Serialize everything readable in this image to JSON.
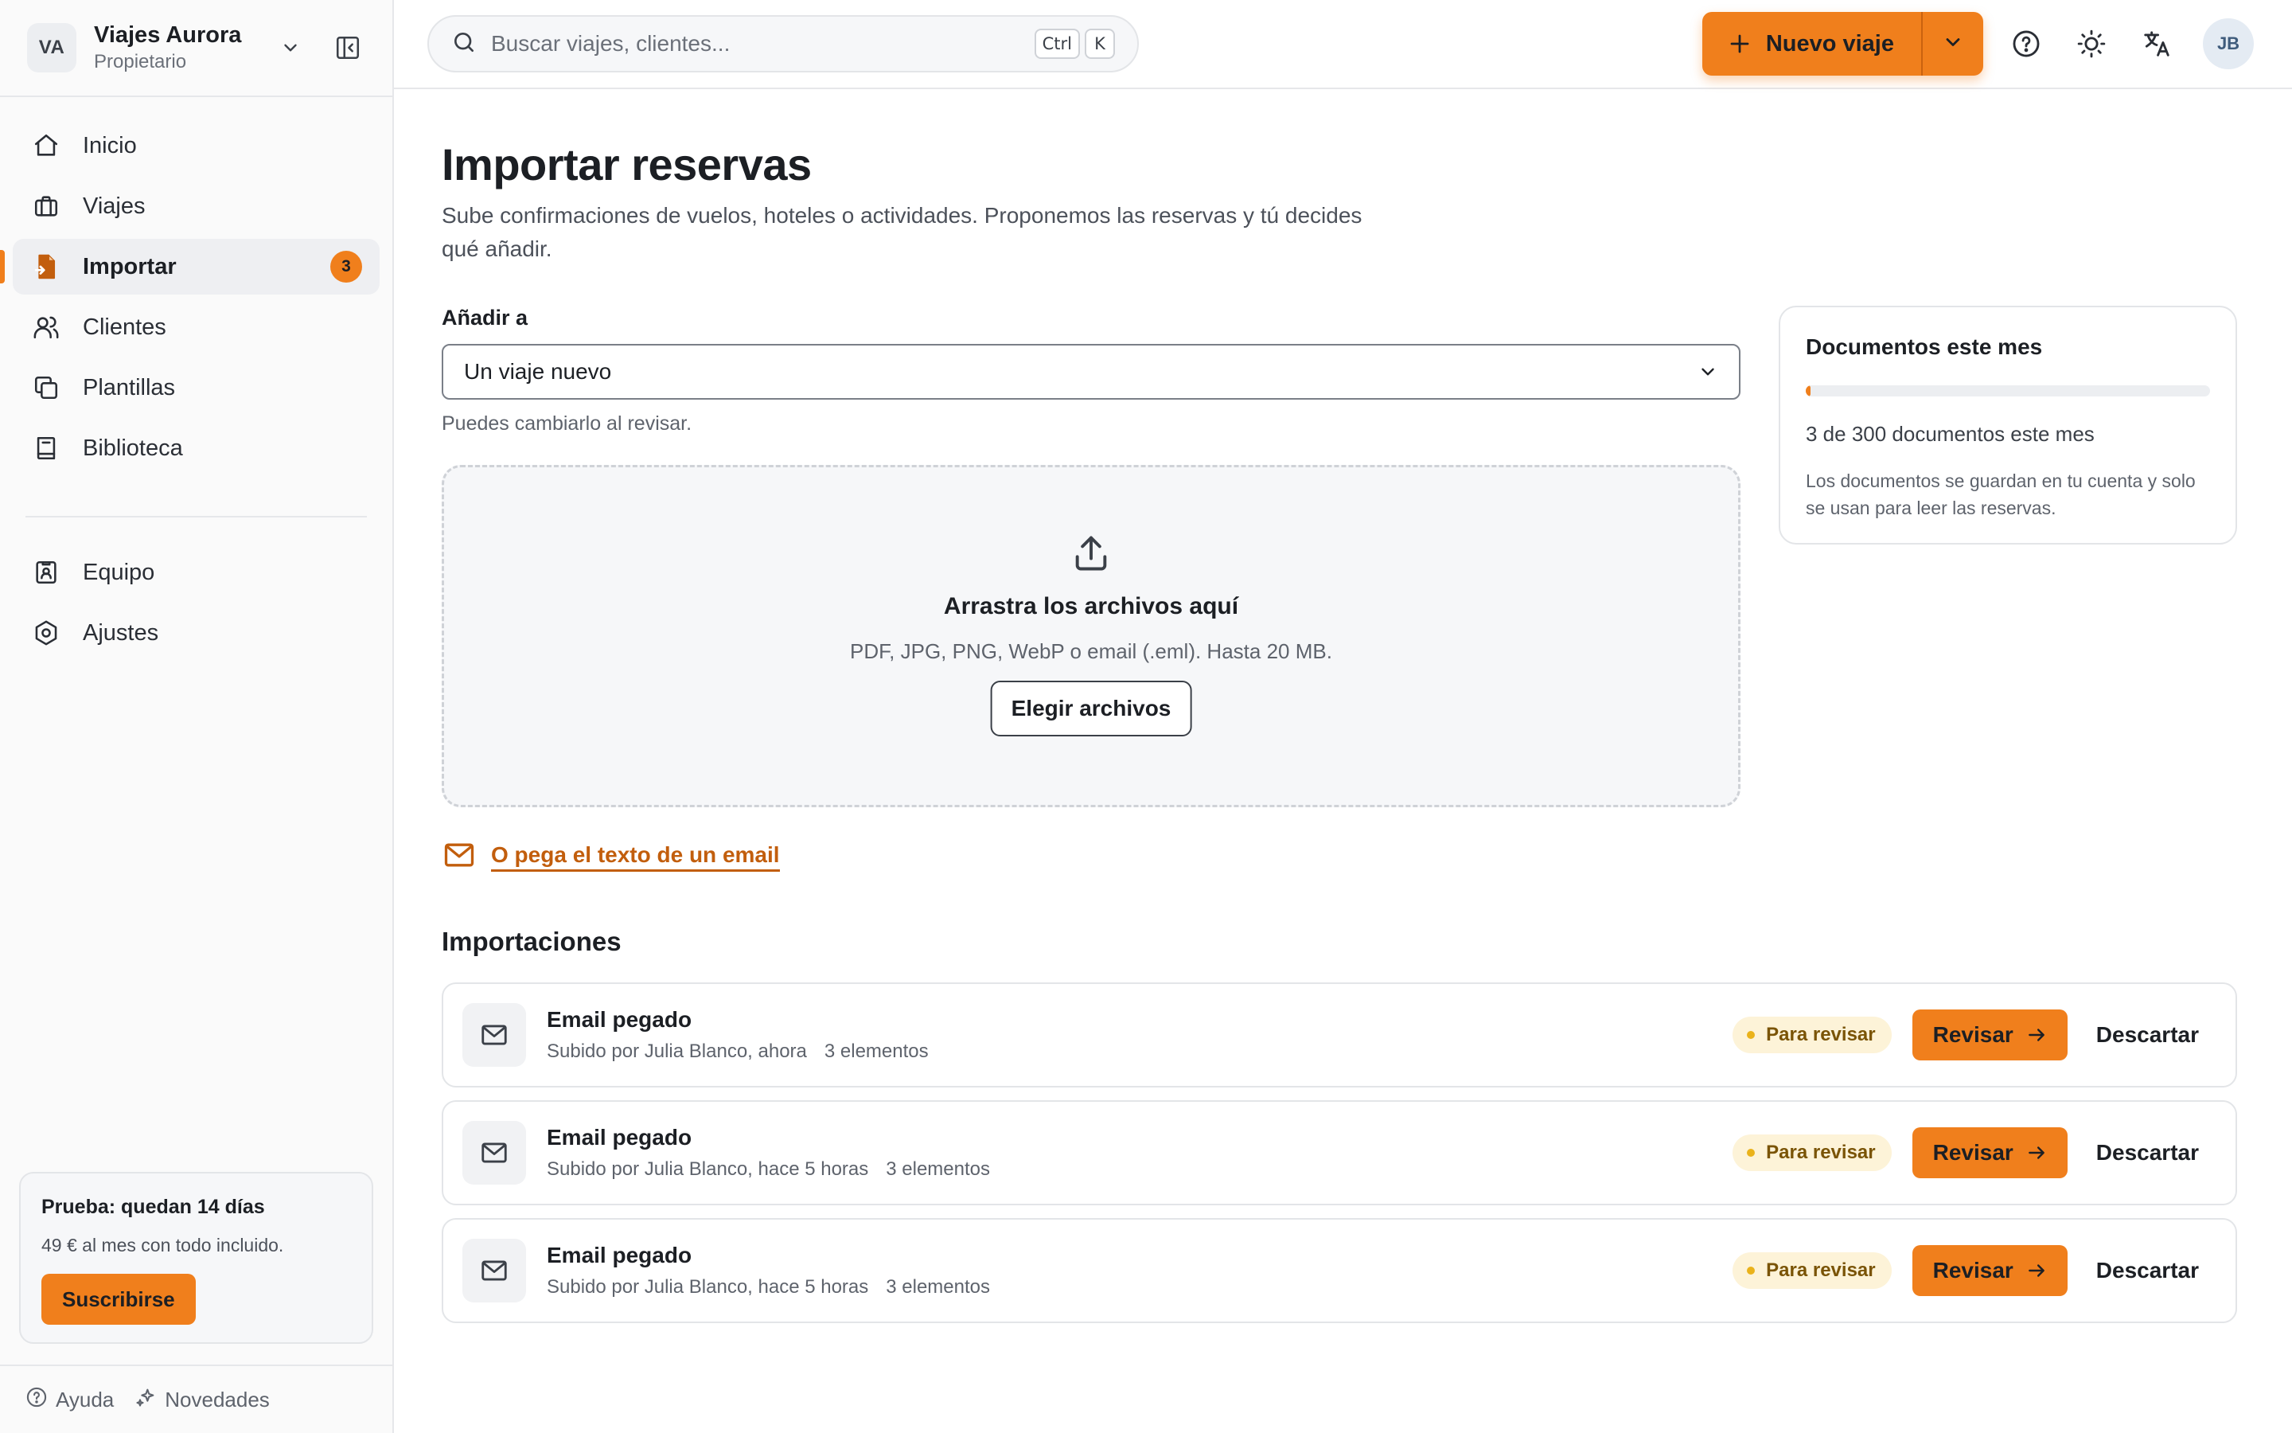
{
  "colors": {
    "accent": "#f07f1c",
    "link": "#c25e0d",
    "status_bg": "#fdf3d8",
    "status_dot": "#eab21a"
  },
  "workspace": {
    "initials": "VA",
    "name": "Viajes Aurora",
    "role": "Propietario"
  },
  "sidebar": {
    "items": [
      {
        "label": "Inicio",
        "icon": "home-icon"
      },
      {
        "label": "Viajes",
        "icon": "briefcase-icon"
      },
      {
        "label": "Importar",
        "icon": "import-file-icon",
        "badge": "3",
        "active": true
      },
      {
        "label": "Clientes",
        "icon": "users-icon"
      },
      {
        "label": "Plantillas",
        "icon": "templates-icon"
      },
      {
        "label": "Biblioteca",
        "icon": "book-icon"
      }
    ],
    "secondary": [
      {
        "label": "Equipo",
        "icon": "team-badge-icon"
      },
      {
        "label": "Ajustes",
        "icon": "gear-icon"
      }
    ],
    "trial": {
      "title": "Prueba: quedan 14 días",
      "subtitle": "49 € al mes con todo incluido.",
      "button": "Suscribirse"
    },
    "footer": {
      "help": "Ayuda",
      "news": "Novedades"
    }
  },
  "topbar": {
    "search_placeholder": "Buscar viajes, clientes...",
    "shortcut_ctrl": "Ctrl",
    "shortcut_key": "K",
    "new_trip": "Nuevo viaje",
    "user_initials": "JB"
  },
  "page": {
    "title": "Importar reservas",
    "subtitle": "Sube confirmaciones de vuelos, hoteles o actividades. Proponemos las reservas y tú decides qué añadir.",
    "add_to_label": "Añadir a",
    "add_to_value": "Un viaje nuevo",
    "add_to_help": "Puedes cambiarlo al revisar.",
    "dropzone": {
      "title": "Arrastra los archivos aquí",
      "formats": "PDF, JPG, PNG, WebP o email (.eml). Hasta 20 MB.",
      "button": "Elegir archivos"
    },
    "paste_link": "O pega el texto de un email"
  },
  "docs": {
    "title": "Documentos este mes",
    "used": 3,
    "limit": 300,
    "count_text": "3 de 300 documentos este mes",
    "note": "Los documentos se guardan en tu cuenta y solo se usan para leer las reservas."
  },
  "imports": {
    "title": "Importaciones",
    "rows": [
      {
        "title": "Email pegado",
        "meta": "Subido por Julia Blanco, ahora",
        "count": "3 elementos",
        "status": "Para revisar",
        "review": "Revisar",
        "discard": "Descartar"
      },
      {
        "title": "Email pegado",
        "meta": "Subido por Julia Blanco, hace 5 horas",
        "count": "3 elementos",
        "status": "Para revisar",
        "review": "Revisar",
        "discard": "Descartar"
      },
      {
        "title": "Email pegado",
        "meta": "Subido por Julia Blanco, hace 5 horas",
        "count": "3 elementos",
        "status": "Para revisar",
        "review": "Revisar",
        "discard": "Descartar"
      }
    ]
  }
}
